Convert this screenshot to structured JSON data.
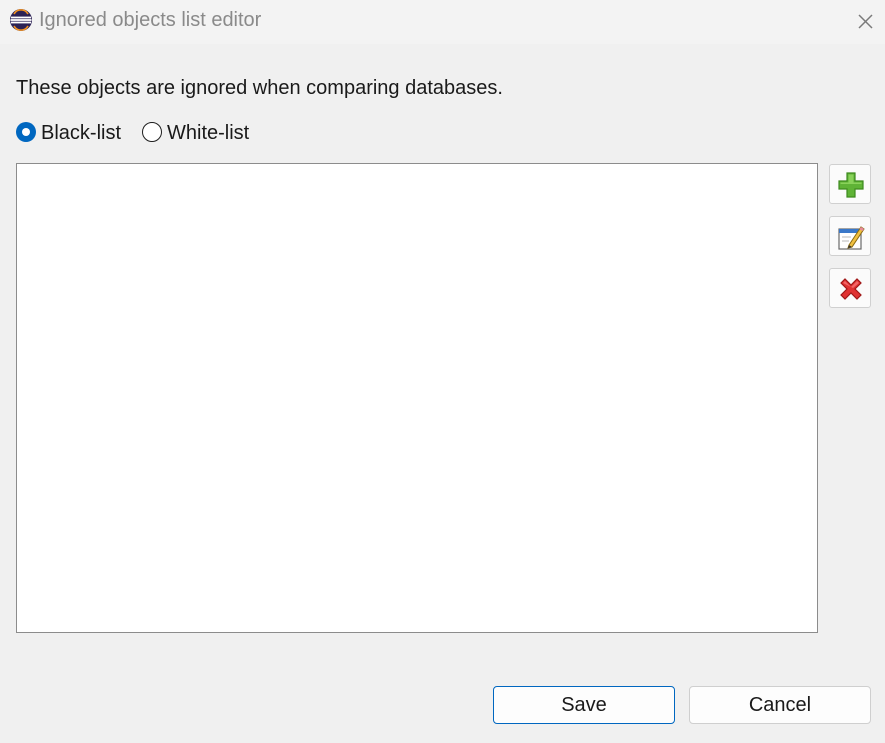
{
  "window": {
    "title": "Ignored objects list editor",
    "app_icon": "eclipse-icon",
    "close_icon": "close-icon"
  },
  "content": {
    "description": "These objects are ignored when comparing databases.",
    "radio_options": [
      {
        "label": "Black-list",
        "checked": true
      },
      {
        "label": "White-list",
        "checked": false
      }
    ],
    "list_items": []
  },
  "side_buttons": [
    {
      "icon": "add-icon"
    },
    {
      "icon": "edit-icon"
    },
    {
      "icon": "delete-icon"
    }
  ],
  "footer": {
    "save_label": "Save",
    "cancel_label": "Cancel"
  },
  "colors": {
    "accent": "#0067c0",
    "background": "#f0f0f0",
    "add_green": "#5fb336",
    "delete_red": "#e03232"
  }
}
